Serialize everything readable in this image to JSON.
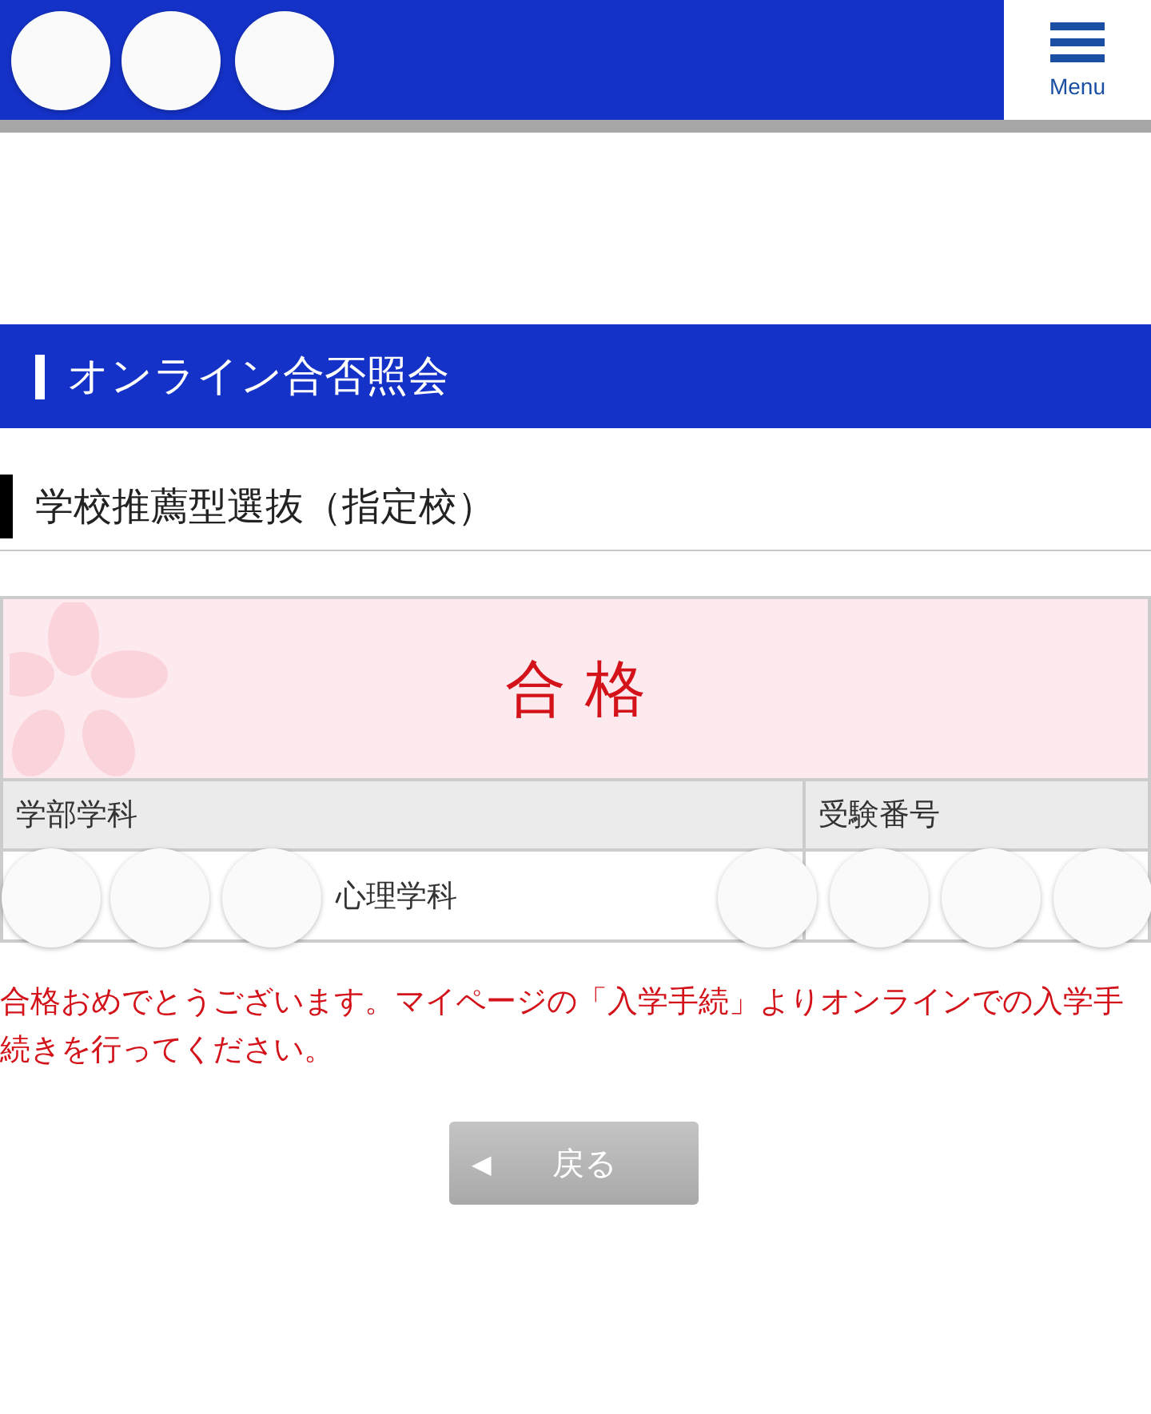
{
  "header": {
    "menu_label": "Menu"
  },
  "section_title": "オンライン合否照会",
  "subtitle": "学校推薦型選抜（指定校）",
  "result": {
    "text": "合 格"
  },
  "table": {
    "columns": [
      "学部学科",
      "受験番号"
    ],
    "rows": [
      [
        "心理学科"
      ]
    ]
  },
  "message": "合格おめでとうございます。マイページの「入学手続」よりオンラインでの入学手続きを行ってください。",
  "back_button": {
    "icon": "◀",
    "label": "戻る"
  }
}
